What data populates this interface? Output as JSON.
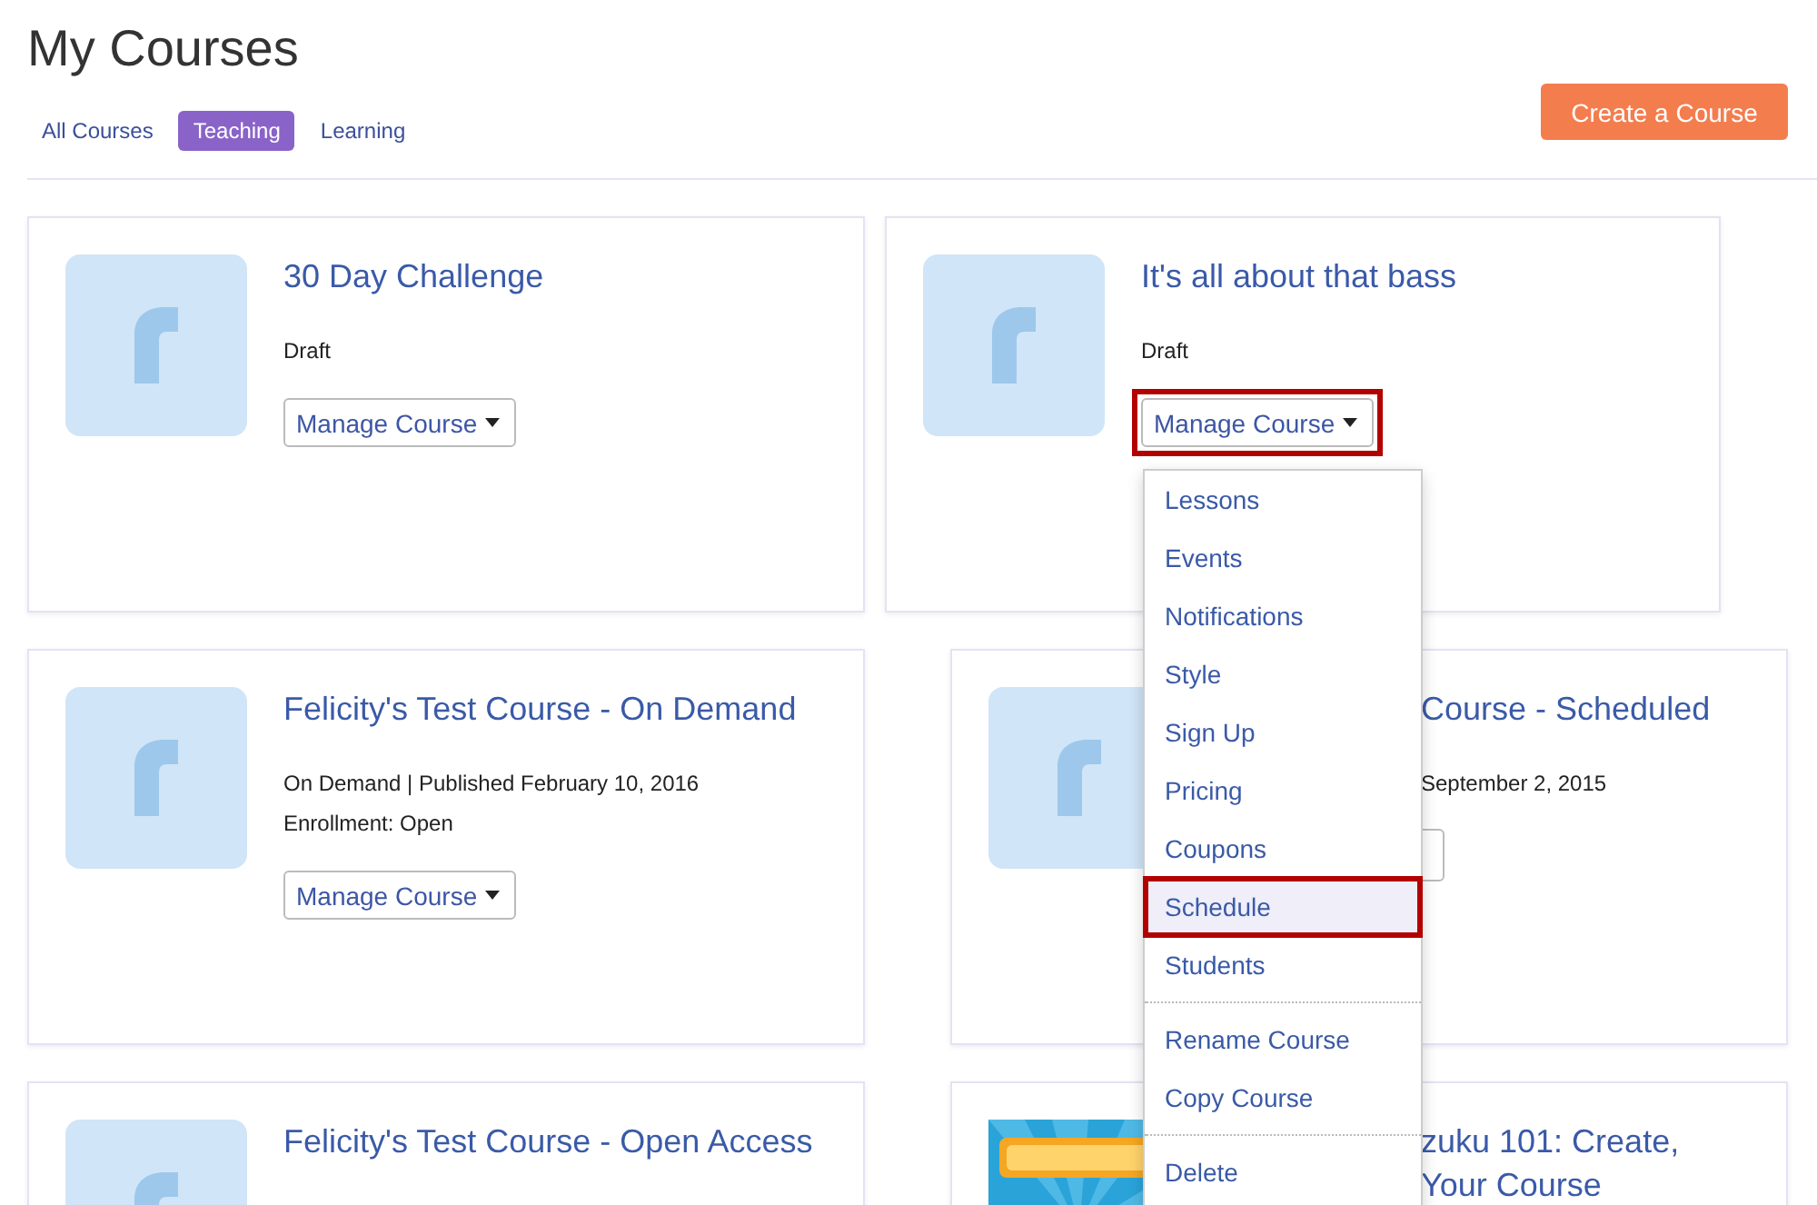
{
  "title": "My Courses",
  "tabs": [
    {
      "label": "All Courses",
      "selected": false
    },
    {
      "label": "Teaching",
      "selected": true
    },
    {
      "label": "Learning",
      "selected": false
    }
  ],
  "create_button": "Create a Course",
  "course_rows": [
    {
      "courses": [
        {
          "kind": "full",
          "thumbnail": {
            "kind": "logo"
          },
          "title": [
            "30 Day Challenge"
          ],
          "meta": [
            "Draft"
          ],
          "manage_button": {
            "kind": "whole",
            "label": "Manage Course",
            "highlighted": false
          }
        },
        {
          "kind": "full",
          "thumbnail": {
            "kind": "logo"
          },
          "title": [
            "It's all about that bass"
          ],
          "meta": [
            "Draft"
          ],
          "manage_button": {
            "kind": "whole",
            "label": "Manage Course",
            "highlighted": true
          }
        }
      ]
    },
    {
      "courses": [
        {
          "kind": "full",
          "thumbnail": {
            "kind": "logo"
          },
          "title": [
            "Felicity's Test Course - On Demand"
          ],
          "meta": [
            "On Demand | Published February 10, 2016",
            "Enrollment: Open"
          ],
          "manage_button": {
            "kind": "whole",
            "label": "Manage Course",
            "highlighted": false
          }
        },
        {
          "kind": "covered",
          "thumbnail": {
            "kind": "logo"
          },
          "title": [
            "Course - Scheduled"
          ],
          "meta": [
            "September 2, 2015"
          ],
          "manage_button": {
            "kind": "edge"
          }
        }
      ]
    },
    {
      "courses": [
        {
          "kind": "full",
          "thumbnail": {
            "kind": "logo"
          },
          "title": [
            "Felicity's Test Course - Open Access"
          ]
        },
        {
          "kind": "covered",
          "thumbnail": {
            "kind": "picture"
          },
          "title": [
            "zuku 101: Create,",
            "Your Course"
          ]
        }
      ]
    }
  ],
  "menu": {
    "items": [
      {
        "kind": "item",
        "label": "Lessons",
        "selected": false
      },
      {
        "kind": "item",
        "label": "Events",
        "selected": false
      },
      {
        "kind": "item",
        "label": "Notifications",
        "selected": false
      },
      {
        "kind": "item",
        "label": "Style",
        "selected": false
      },
      {
        "kind": "item",
        "label": "Sign Up",
        "selected": false
      },
      {
        "kind": "item",
        "label": "Pricing",
        "selected": false
      },
      {
        "kind": "item",
        "label": "Coupons",
        "selected": false
      },
      {
        "kind": "item",
        "label": "Schedule",
        "selected": true
      },
      {
        "kind": "item",
        "label": "Students",
        "selected": false
      },
      {
        "kind": "divider"
      },
      {
        "kind": "item",
        "label": "Rename Course",
        "selected": false
      },
      {
        "kind": "item",
        "label": "Copy Course",
        "selected": false
      },
      {
        "kind": "divider"
      },
      {
        "kind": "item",
        "label": "Delete",
        "selected": false
      }
    ]
  }
}
